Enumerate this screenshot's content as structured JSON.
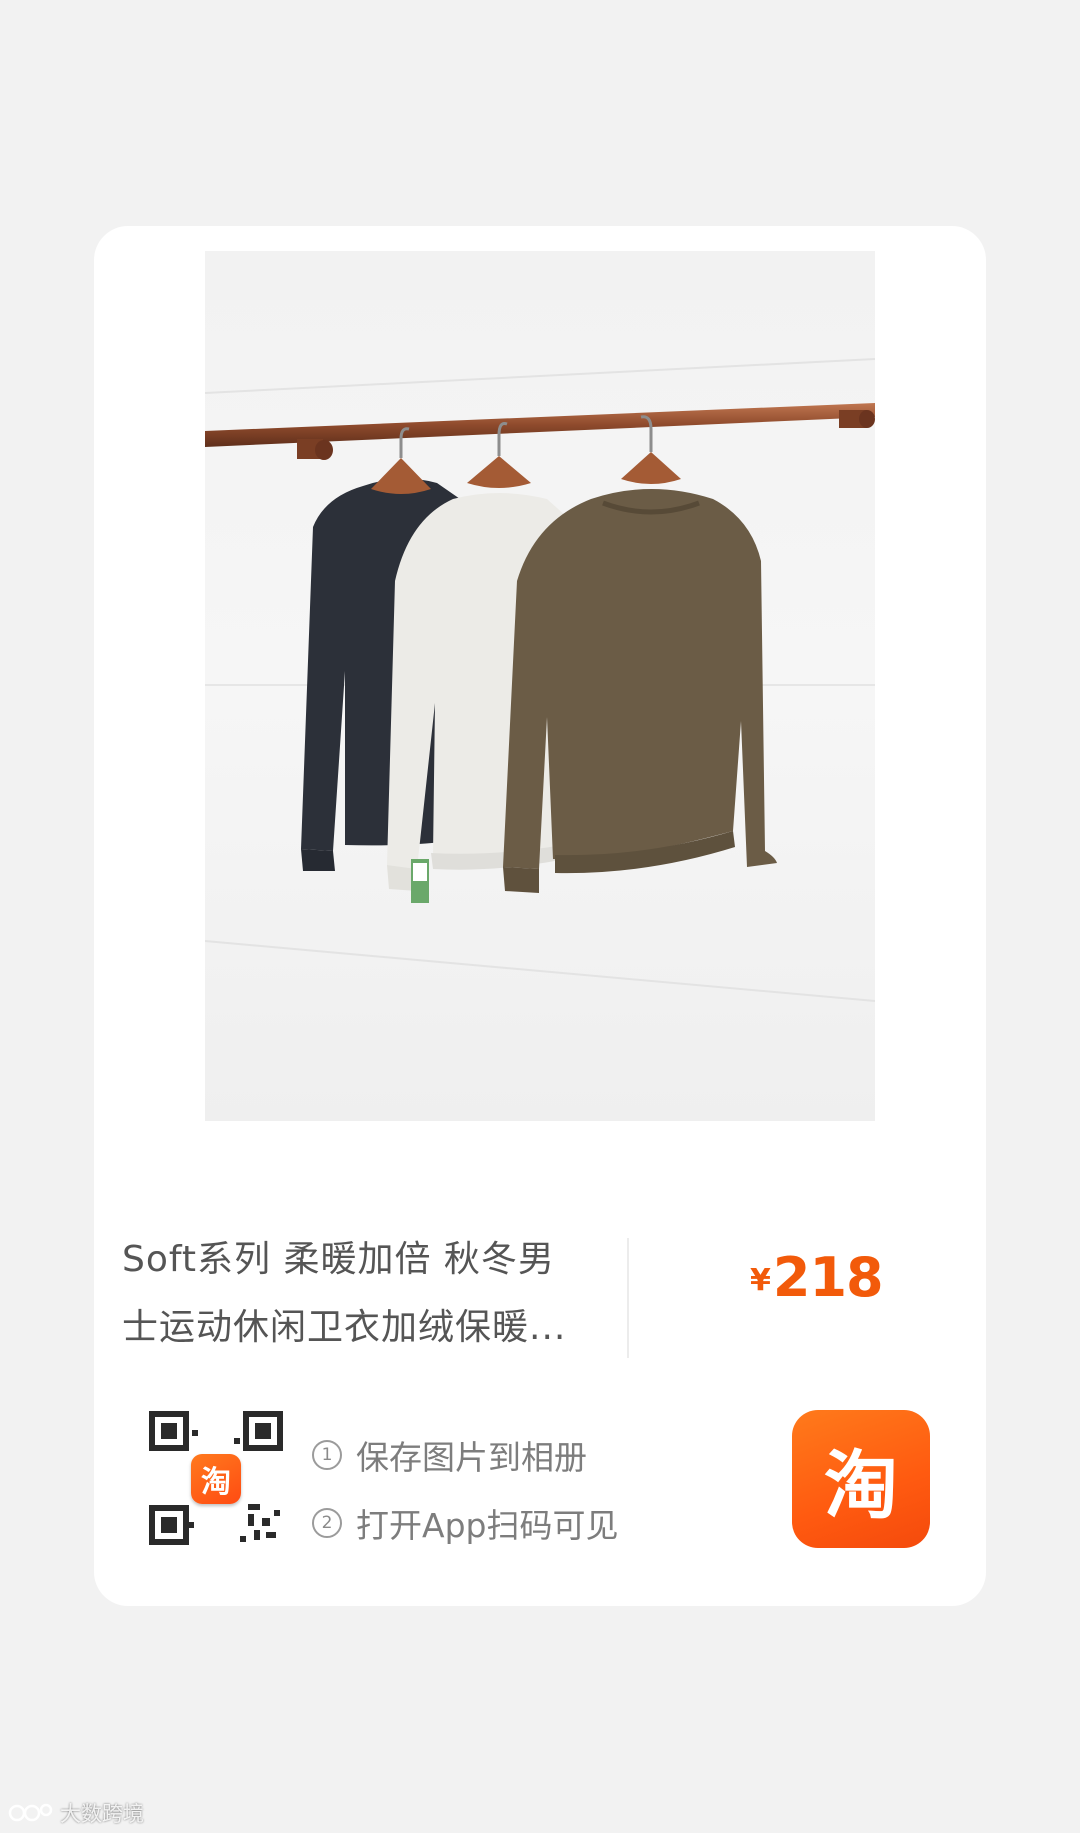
{
  "product": {
    "title_line1": "Soft系列 柔暖加倍 秋冬男",
    "title_line2": "士运动休闲卫衣加绒保暖...",
    "price_symbol": "¥",
    "price": "218",
    "price_color": "#f25a0a",
    "image_icon": "sweatshirts-on-rack-photo"
  },
  "qr": {
    "icon": "qr-code-icon",
    "logo_text": "淘"
  },
  "steps": [
    {
      "num": "1",
      "text": "保存图片到相册"
    },
    {
      "num": "2",
      "text": "打开App扫码可见"
    }
  ],
  "taobao_logo": {
    "text": "淘",
    "color": "#ff5a10"
  },
  "watermark": {
    "text": "大数跨境"
  }
}
